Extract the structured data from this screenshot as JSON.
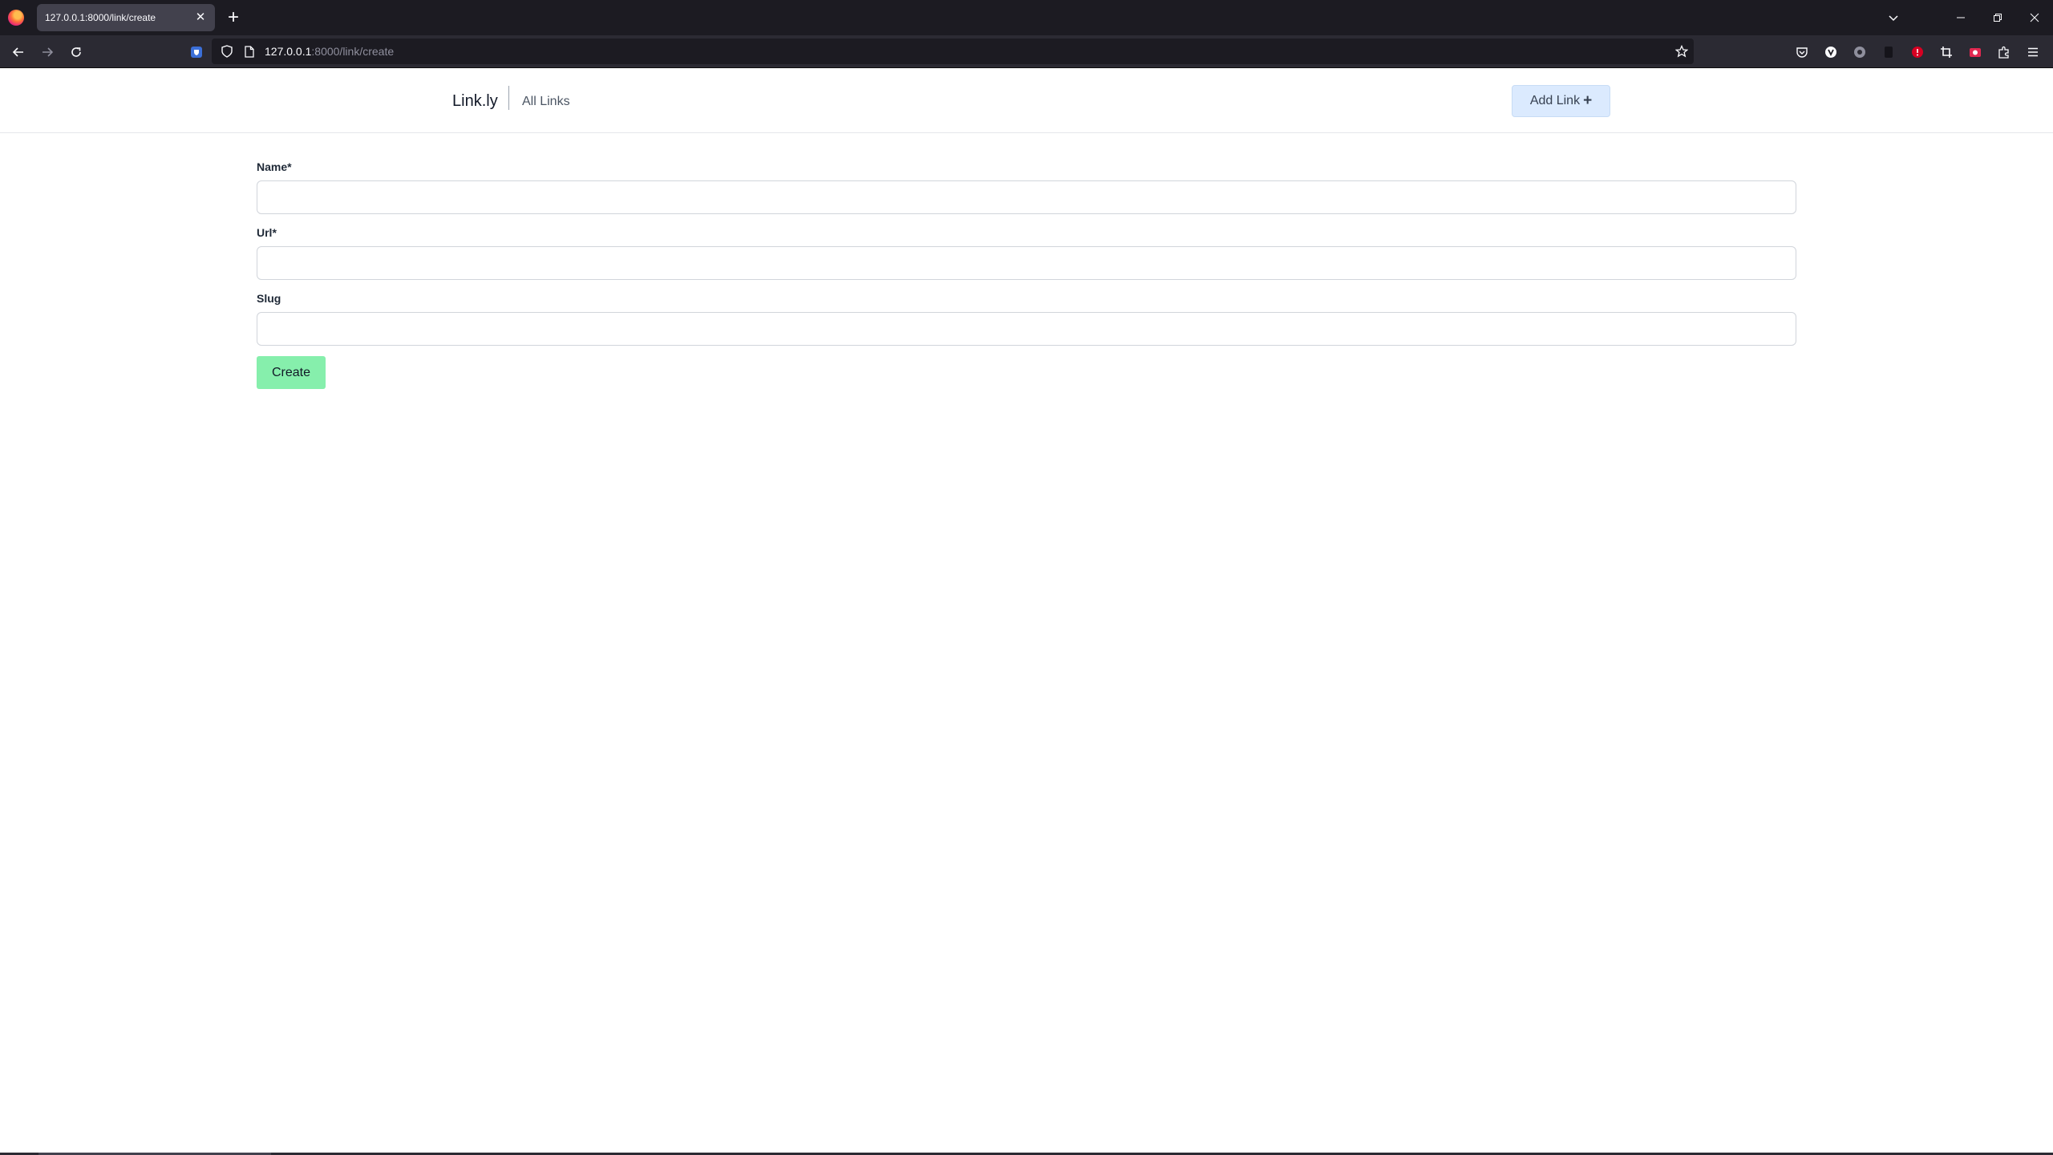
{
  "browser": {
    "tab_title": "127.0.0.1:8000/link/create",
    "tab_close_glyph": "✕",
    "new_tab_glyph": "+",
    "url_host": "127.0.0.1",
    "url_path": ":8000/link/create"
  },
  "header": {
    "brand": "Link.ly",
    "nav_all_links": "All Links",
    "add_link_label": "Add Link",
    "add_link_icon": "+"
  },
  "form": {
    "name_label": "Name*",
    "url_label": "Url*",
    "slug_label": "Slug",
    "name_value": "",
    "url_value": "",
    "slug_value": "",
    "submit_label": "Create"
  },
  "colors": {
    "add_link_bg": "#dbeafe",
    "create_bg": "#86efac",
    "chrome_dark": "#1c1b22",
    "toolbar": "#2b2a33"
  }
}
